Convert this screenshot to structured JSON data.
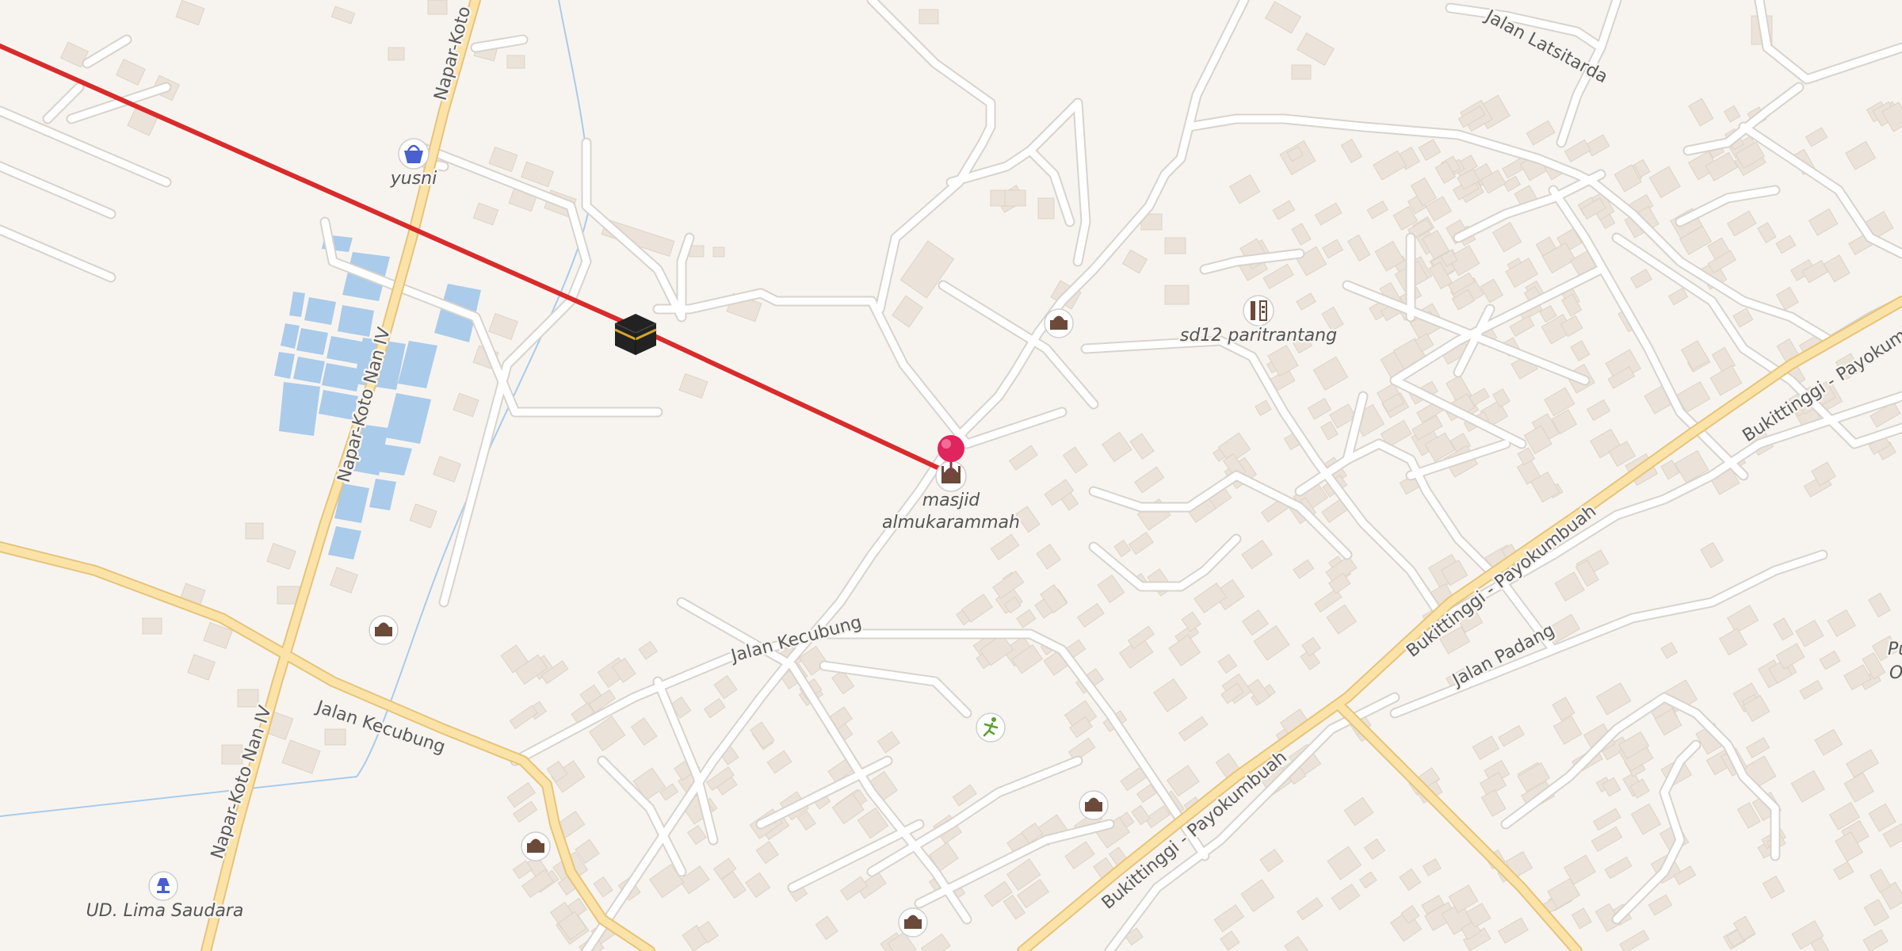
{
  "map": {
    "colors": {
      "background": "#f7f4f0",
      "minor_road": "#ffffff",
      "minor_road_casing": "#d8d3cc",
      "major_road": "#fbe3a8",
      "major_road_casing": "#e7c37a",
      "building": "#ebe3d9",
      "building_stroke": "#dcd2c6",
      "water": "#aacbea",
      "route": "#d92b2b",
      "pin": "#e0245e",
      "poi_fill": "#ffffff",
      "poi_icon": "#6b4a3a"
    },
    "roads": {
      "napar_koto_top": "Napar-Koto",
      "napar_koto_mid": "Napar-Koto Nan IV",
      "napar_koto_bottom": "Napar-Koto Nan IV",
      "jalan_kecubung_west": "Jalan Kecubung",
      "jalan_kecubung_mid": "Jalan Kecubung",
      "jalan_latsitarda": "Jalan Latsitarda",
      "bukittinggi_payakumbuah_east": "Bukittinggi - Payokumbuah",
      "bukittinggi_payakumbuah_ne": "Bukittinggi - Payokumbuah",
      "bukittinggi_payakumbuah_sw": "Bukittinggi - Payokumbuah",
      "jalan_padang": "Jalan Padang"
    },
    "places": {
      "yusni": "yusni",
      "sd12": "sd12 paritrantang",
      "masjid_line1": "masjid",
      "masjid_line2": "almukarammah",
      "ud_lima": "UD. Lima Saudara",
      "edge_partial_1": "Pu",
      "edge_partial_2": "O"
    },
    "icons": {
      "shop": "basket-icon",
      "school": "school-icon",
      "mosque": "mosque-icon",
      "kaaba": "kaaba-icon",
      "sports": "sports-icon",
      "lamp_shop": "lamp-icon",
      "pin": "map-pin-icon"
    }
  }
}
